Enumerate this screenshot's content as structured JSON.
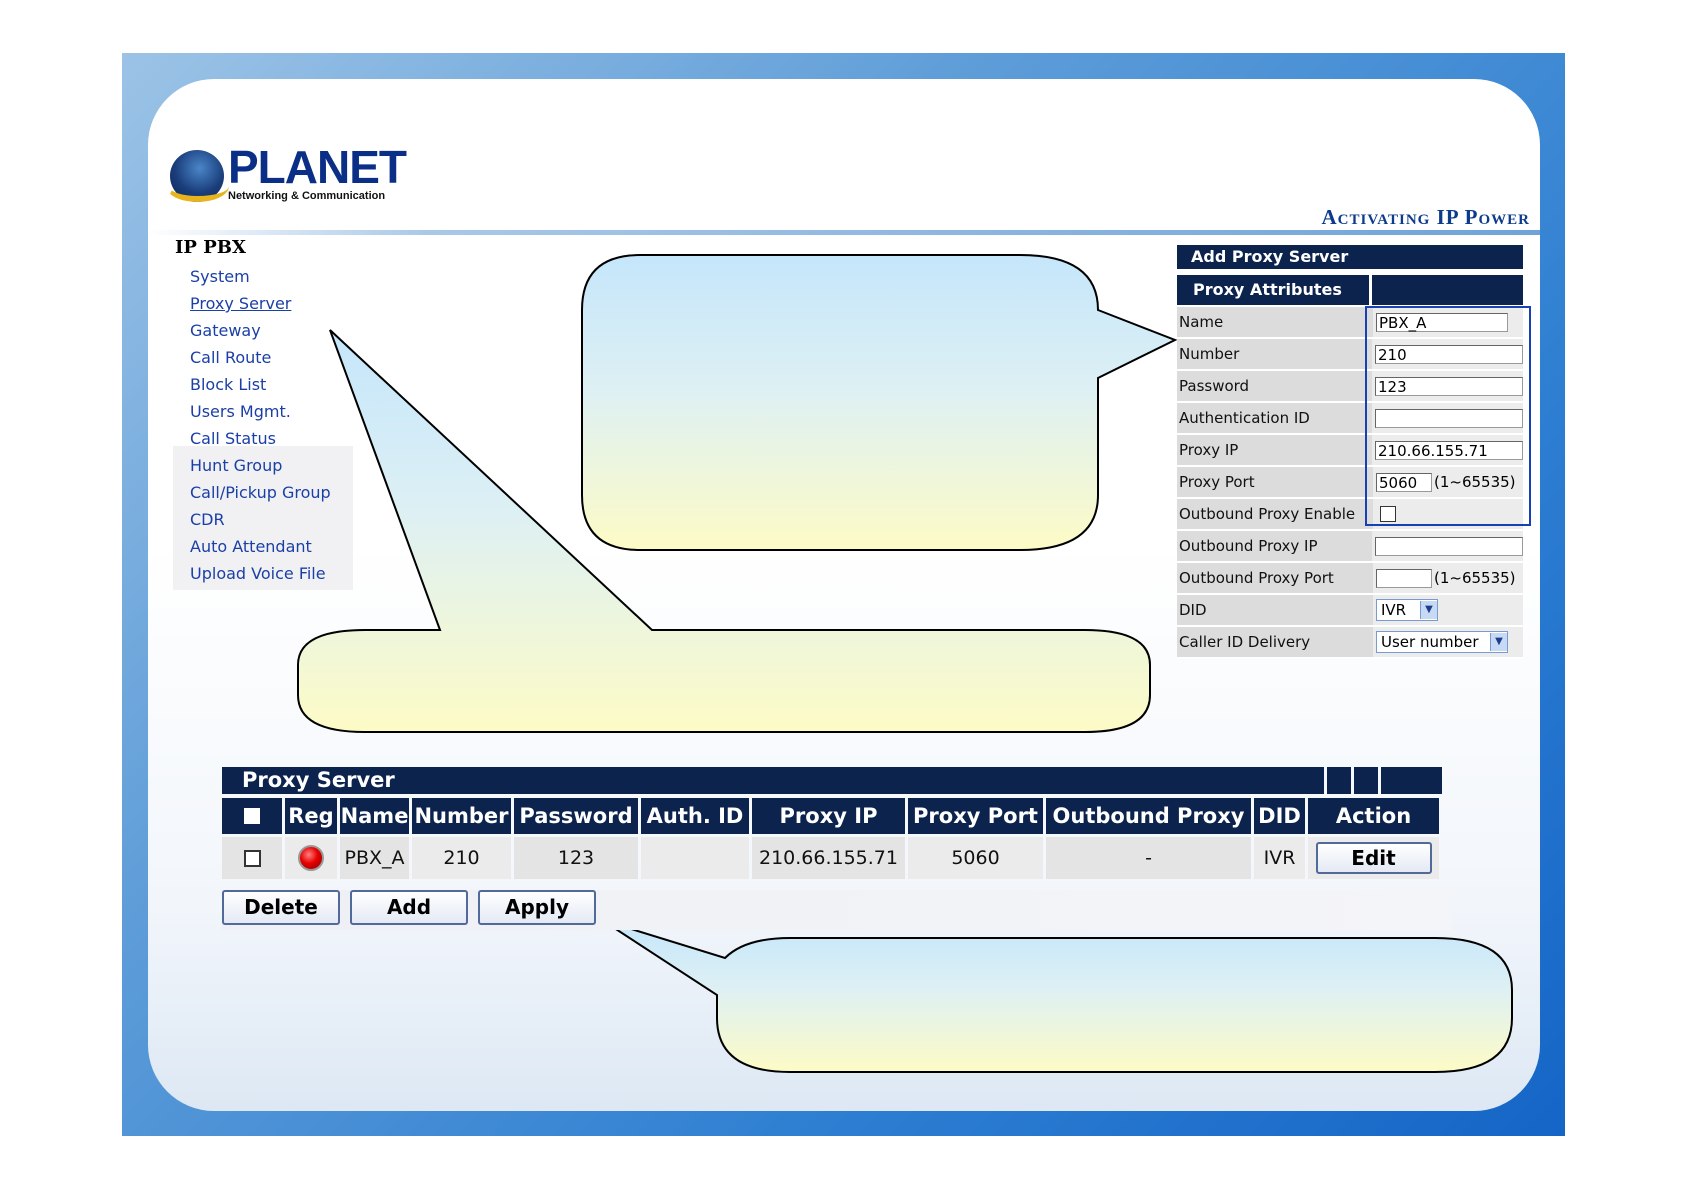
{
  "brand": {
    "logo_word": "PLANET",
    "logo_tagline": "Networking & Communication",
    "slogan": "Activating IP Power",
    "accent_navy": "#0c234e",
    "frame_blue": "#1565c7"
  },
  "nav": {
    "title": "IP PBX",
    "items": [
      {
        "label": "System"
      },
      {
        "label": "Proxy Server"
      },
      {
        "label": "Gateway"
      },
      {
        "label": "Call Route"
      },
      {
        "label": "Block List"
      },
      {
        "label": "Users Mgmt."
      },
      {
        "label": "Call Status"
      },
      {
        "label": "Hunt Group"
      },
      {
        "label": "Call/Pickup Group"
      },
      {
        "label": "CDR"
      },
      {
        "label": "Auto Attendant"
      },
      {
        "label": "Upload Voice File"
      }
    ]
  },
  "form": {
    "title": "Add Proxy Server",
    "section": "Proxy Attributes",
    "name_label": "Name",
    "name_value": "PBX_A",
    "number_label": "Number",
    "number_value": "210",
    "password_label": "Password",
    "password_value": "123",
    "auth_label": "Authentication ID",
    "auth_value": "",
    "proxy_ip_label": "Proxy IP",
    "proxy_ip_value": "210.66.155.71",
    "proxy_port_label": "Proxy Port",
    "proxy_port_value": "5060",
    "proxy_port_range": "(1~65535)",
    "outbound_enable_label": "Outbound Proxy Enable",
    "outbound_ip_label": "Outbound Proxy IP",
    "outbound_ip_value": "",
    "outbound_port_label": "Outbound Proxy Port",
    "outbound_port_value": "",
    "outbound_port_range": "(1~65535)",
    "did_label": "DID",
    "did_value": "IVR",
    "callerid_label": "Caller ID Delivery",
    "callerid_value": "User number"
  },
  "table": {
    "title": "Proxy Server",
    "headers": {
      "reg": "Reg",
      "name": "Name",
      "number": "Number",
      "password": "Password",
      "auth": "Auth. ID",
      "proxy_ip": "Proxy IP",
      "proxy_port": "Proxy Port",
      "outbound": "Outbound Proxy",
      "did": "DID",
      "action": "Action"
    },
    "row": {
      "name": "PBX_A",
      "number": "210",
      "password": "123",
      "auth": "",
      "proxy_ip": "210.66.155.71",
      "proxy_port": "5060",
      "outbound": "-",
      "did": "IVR",
      "action": "Edit"
    }
  },
  "buttons": {
    "delete": "Delete",
    "add": "Add",
    "apply": "Apply"
  }
}
